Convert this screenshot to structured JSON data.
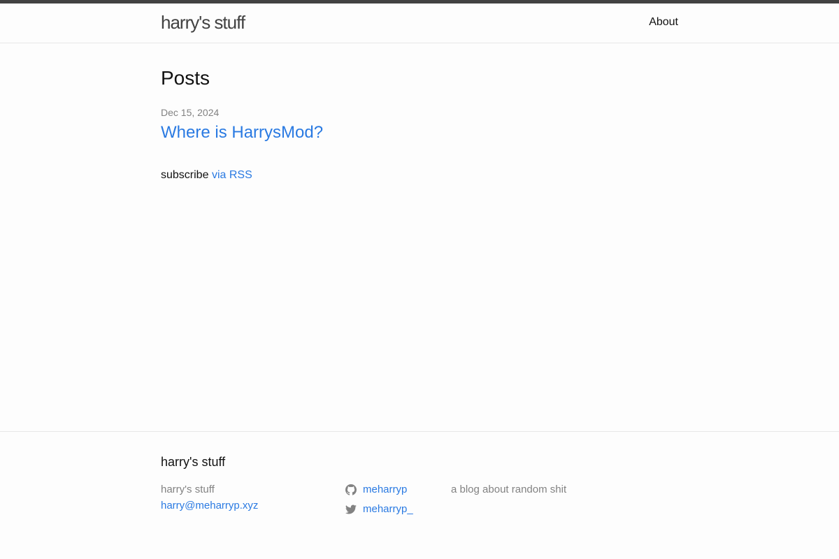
{
  "header": {
    "site_title": "harry's stuff",
    "nav": [
      {
        "label": "About"
      }
    ]
  },
  "main": {
    "heading": "Posts",
    "posts": [
      {
        "date": "Dec 15, 2024",
        "title": "Where is HarrysMod?"
      }
    ],
    "subscribe_text": "subscribe",
    "rss_link": "via RSS"
  },
  "footer": {
    "heading": "harry's stuff",
    "name": "harry's stuff",
    "email": "harry@meharryp.xyz",
    "social": [
      {
        "icon": "github-icon",
        "handle": "meharryp"
      },
      {
        "icon": "twitter-icon",
        "handle": "meharryp_"
      }
    ],
    "description": "a blog about random shit"
  },
  "colors": {
    "accent_link": "#2a7ae2",
    "header_bar": "#424242",
    "muted_text": "#828282",
    "background": "#fdfdfd"
  }
}
